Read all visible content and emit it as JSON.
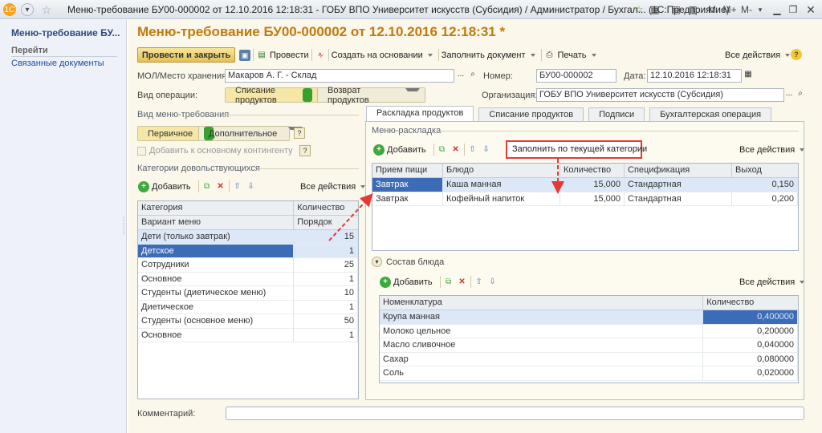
{
  "window": {
    "title": "Меню-требование БУ00-000002 от 12.10.2016 12:18:31 - ГОБУ ВПО Университет искусств (Субсидия) / Администратор / Бухгал...",
    "app": "(1С:Предприятие)",
    "memory_buttons": [
      "M",
      "M+",
      "M-"
    ]
  },
  "sidebar": {
    "title": "Меню-требование БУ...",
    "goto": "Перейти",
    "related": "Связанные документы"
  },
  "doc": {
    "title": "Меню-требование БУ00-000002 от 12.10.2016 12:18:31 *"
  },
  "toolbar": {
    "post_close": "Провести и закрыть",
    "post": "Провести",
    "create_based": "Создать на основании",
    "fill_doc": "Заполнить документ",
    "print": "Печать",
    "all_actions": "Все действия",
    "help": "?"
  },
  "form": {
    "mol_label": "МОЛ/Место хранения:",
    "mol_value": "Макаров А. Г. - Склад",
    "number_label": "Номер:",
    "number_value": "БУ00-000002",
    "date_label": "Дата:",
    "date_value": "12.10.2016 12:18:31",
    "op_label": "Вид операции:",
    "op_options": [
      "Списание продуктов",
      "Возврат продуктов"
    ],
    "org_label": "Организация:",
    "org_value": "ГОБУ ВПО Университет искусств (Субсидия)"
  },
  "menu_type": {
    "group_title": "Вид меню-требования",
    "options": [
      "Первичное",
      "Дополнительное"
    ],
    "help": "?",
    "add_to_contingent": "Добавить к основному контингенту",
    "help2": "?"
  },
  "categories": {
    "group_title": "Категории довольствующихся",
    "add": "Добавить",
    "all_actions": "Все действия",
    "headers": [
      "Категория",
      "Количество"
    ],
    "subheaders": [
      "Вариант меню",
      "Порядок"
    ],
    "rows": [
      {
        "name": "Дети (только завтрак)",
        "qty": "15"
      },
      {
        "name": "Детское",
        "qty": "1"
      },
      {
        "name": "Сотрудники",
        "qty": "25"
      },
      {
        "name": "Основное",
        "qty": "1"
      },
      {
        "name": "Студенты (диетическое меню)",
        "qty": "10"
      },
      {
        "name": "Диетическое",
        "qty": "1"
      },
      {
        "name": "Студенты (основное меню)",
        "qty": "50"
      },
      {
        "name": "Основное",
        "qty": "1"
      }
    ]
  },
  "tabs": [
    "Раскладка продуктов",
    "Списание продуктов",
    "Подписи",
    "Бухгалтерская операция"
  ],
  "layout_section": {
    "group_title": "Меню-раскладка",
    "add": "Добавить",
    "fill_by_category": "Заполнить по текущей категории",
    "all_actions": "Все действия",
    "headers": [
      "Прием пищи",
      "Блюдо",
      "Количество",
      "Спецификация",
      "Выход"
    ],
    "rows": [
      {
        "meal": "Завтрак",
        "dish": "Каша манная",
        "qty": "15,000",
        "spec": "Стандартная",
        "out": "0,150"
      },
      {
        "meal": "Завтрак",
        "dish": "Кофейный напиток",
        "qty": "15,000",
        "spec": "Стандартная",
        "out": "0,200"
      }
    ]
  },
  "composition": {
    "title": "Состав блюда",
    "add": "Добавить",
    "all_actions": "Все действия",
    "headers": [
      "Номенклатура",
      "Количество"
    ],
    "rows": [
      {
        "name": "Крупа манная",
        "qty": "0,400000"
      },
      {
        "name": "Молоко цельное",
        "qty": "0,200000"
      },
      {
        "name": "Масло сливочное",
        "qty": "0,040000"
      },
      {
        "name": "Сахар",
        "qty": "0,080000"
      },
      {
        "name": "Соль",
        "qty": "0,020000"
      }
    ]
  },
  "comment": {
    "label": "Комментарий:",
    "value": ""
  },
  "colors": {
    "accent": "#c07a10",
    "selection": "#3c6bb7",
    "annotation": "#e53935"
  }
}
